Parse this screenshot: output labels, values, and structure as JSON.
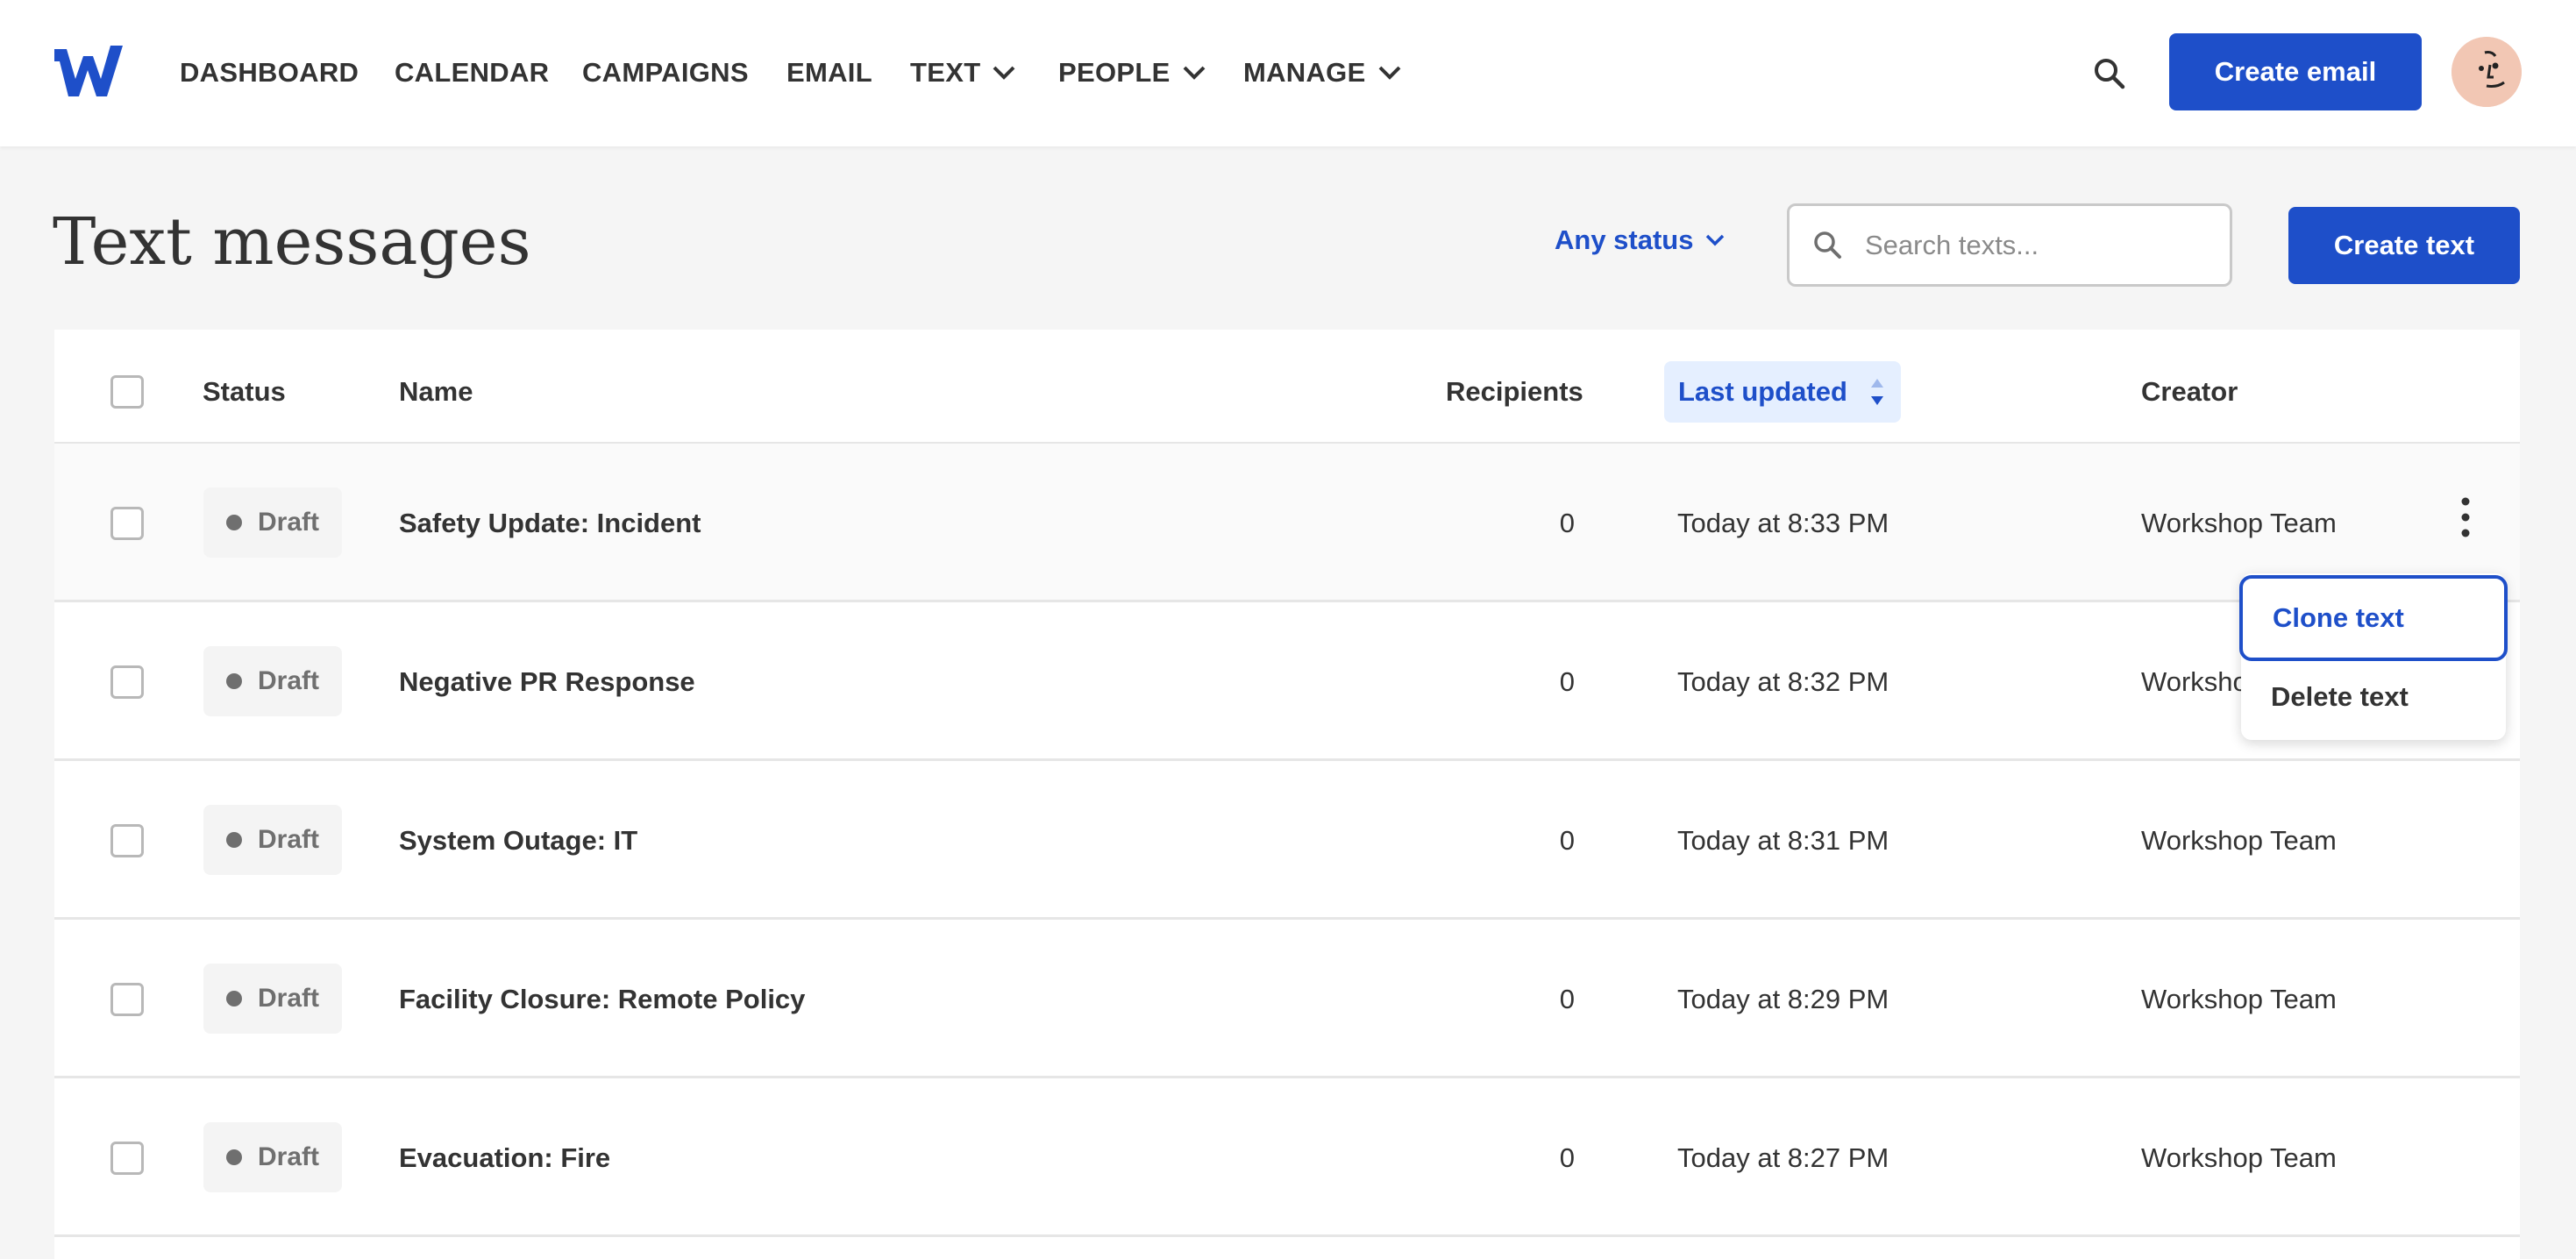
{
  "nav": {
    "items": [
      {
        "label": "DASHBOARD",
        "dropdown": false
      },
      {
        "label": "CALENDAR",
        "dropdown": false
      },
      {
        "label": "CAMPAIGNS",
        "dropdown": false
      },
      {
        "label": "EMAIL",
        "dropdown": false
      },
      {
        "label": "TEXT",
        "dropdown": true
      },
      {
        "label": "PEOPLE",
        "dropdown": true
      },
      {
        "label": "MANAGE",
        "dropdown": true
      }
    ],
    "create_email_label": "Create email"
  },
  "header": {
    "title": "Text messages",
    "status_filter": "Any status",
    "search_placeholder": "Search texts...",
    "create_text_label": "Create text"
  },
  "table": {
    "columns": {
      "status": "Status",
      "name": "Name",
      "recipients": "Recipients",
      "last_updated": "Last updated",
      "creator": "Creator"
    },
    "rows": [
      {
        "status": "Draft",
        "name": "Safety Update: Incident",
        "recipients": "0",
        "updated": "Today at 8:33 PM",
        "creator": "Workshop Team"
      },
      {
        "status": "Draft",
        "name": "Negative PR Response",
        "recipients": "0",
        "updated": "Today at 8:32 PM",
        "creator": "Workshop Team"
      },
      {
        "status": "Draft",
        "name": "System Outage: IT",
        "recipients": "0",
        "updated": "Today at 8:31 PM",
        "creator": "Workshop Team"
      },
      {
        "status": "Draft",
        "name": "Facility Closure: Remote Policy",
        "recipients": "0",
        "updated": "Today at 8:29 PM",
        "creator": "Workshop Team"
      },
      {
        "status": "Draft",
        "name": "Evacuation: Fire",
        "recipients": "0",
        "updated": "Today at 8:27 PM",
        "creator": "Workshop Team"
      }
    ]
  },
  "context_menu": {
    "clone_label": "Clone text",
    "delete_label": "Delete text"
  },
  "colors": {
    "brand": "#1e4fc9",
    "sort_header_bg": "#e5efff",
    "draft_dot": "#6f6f6f"
  },
  "icons": {
    "logo": "w-logo-icon",
    "search": "search-icon",
    "dropdown": "chevron-down-icon",
    "sort": "sort-icon",
    "more": "kebab-icon"
  }
}
